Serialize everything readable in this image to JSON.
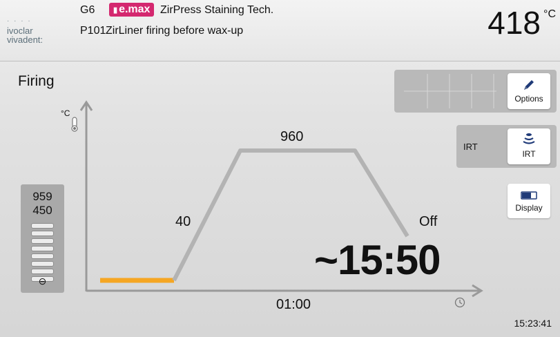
{
  "header": {
    "logo_top": "ivoclar",
    "logo_bottom": "vivadent:",
    "furnace_label": "G6",
    "brand_badge": "e.max",
    "program_title": "ZirPress Staining Tech.",
    "program_number": "P101",
    "program_name": "ZirLiner firing before wax-up",
    "temperature": "418",
    "temperature_unit": "°C"
  },
  "main": {
    "title": "Firing",
    "axis_unit": "°C",
    "hold_temperature": "960",
    "heat_rate": "40",
    "cooling": "Off",
    "remaining_time": "~15:50",
    "hold_time": "01:00",
    "clock": "15:23:41"
  },
  "vacuum": {
    "upper": "959",
    "lower": "450"
  },
  "side_buttons": {
    "options_label": "Options",
    "irt_label": "IRT",
    "irt_button_label": "IRT",
    "display_label": "Display"
  },
  "colors": {
    "curve": "#b3b3b3",
    "predrying": "#f5a623",
    "brand": "#d4286f",
    "axis": "#9a9a9a",
    "accent_icon": "#1f3a78"
  },
  "icons": {
    "options": "pencil-icon",
    "irt": "irt-sensor-icon",
    "display": "display-toggle-icon",
    "thermometer": "thermometer-icon",
    "time": "clock-icon",
    "vacuum": "vacuum-icon"
  }
}
